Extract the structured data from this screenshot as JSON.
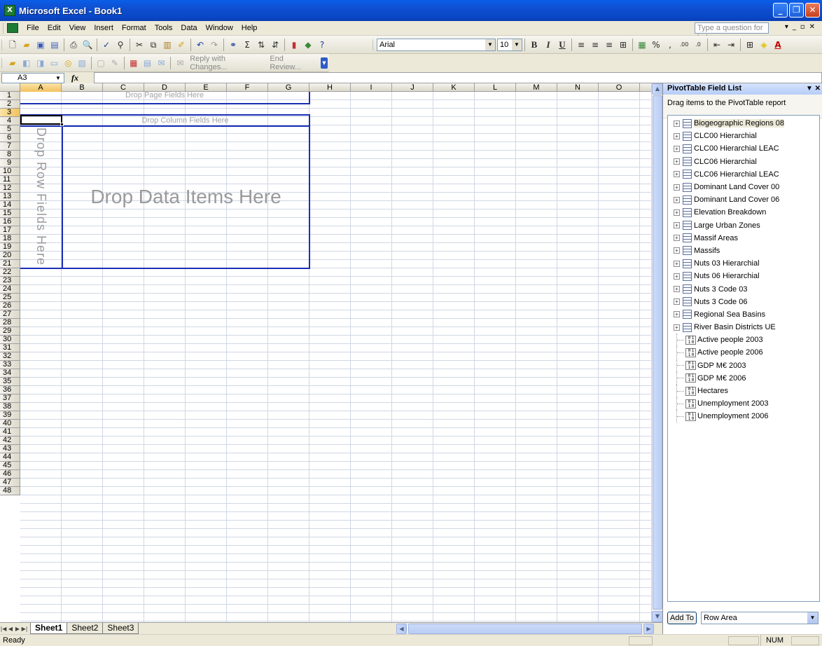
{
  "window": {
    "title": "Microsoft Excel - Book1",
    "app_icon": "X"
  },
  "menubar": {
    "items": [
      "File",
      "Edit",
      "View",
      "Insert",
      "Format",
      "Tools",
      "Data",
      "Window",
      "Help"
    ],
    "help_placeholder": "Type a question for help"
  },
  "toolbar_format": {
    "font": "Arial",
    "size": "10"
  },
  "toolbar_review": {
    "reply_label": "Reply with Changes...",
    "end_review_label": "End Review..."
  },
  "formula_bar": {
    "name_box": "A3",
    "fx_label": "fx",
    "formula": ""
  },
  "grid": {
    "columns": [
      "A",
      "B",
      "C",
      "D",
      "E",
      "F",
      "G",
      "H",
      "I",
      "J",
      "K",
      "L",
      "M",
      "N",
      "O"
    ],
    "selected_column": "A",
    "rows": [
      "1",
      "2",
      "3",
      "4",
      "5",
      "6",
      "7",
      "8",
      "9",
      "10",
      "11",
      "12",
      "13",
      "14",
      "15",
      "16",
      "17",
      "18",
      "19",
      "20",
      "21",
      "22",
      "23",
      "24",
      "25",
      "26",
      "27",
      "28",
      "29",
      "30",
      "31",
      "32",
      "33",
      "34",
      "35",
      "36",
      "37",
      "38",
      "39",
      "40",
      "41",
      "42",
      "43",
      "44",
      "45",
      "46",
      "47",
      "48"
    ],
    "selected_row": "3"
  },
  "pivot": {
    "page_drop": "Drop Page Fields Here",
    "column_drop": "Drop Column Fields Here",
    "row_drop": "Drop Row Fields Here",
    "data_drop": "Drop Data Items Here"
  },
  "sheets": {
    "tabs": [
      "Sheet1",
      "Sheet2",
      "Sheet3"
    ],
    "active": "Sheet1"
  },
  "status": {
    "left": "Ready",
    "num": "NUM"
  },
  "pane": {
    "title": "PivotTable Field List",
    "description": "Drag items to the PivotTable report",
    "dimension_fields": [
      "Biogeographic Regions 08",
      "CLC00 Hierarchial",
      "CLC00 Hierarchial LEAC",
      "CLC06 Hierarchial",
      "CLC06 Hierarchial LEAC",
      "Dominant Land Cover 00",
      "Dominant Land Cover 06",
      "Elevation Breakdown",
      "Large Urban Zones",
      "Massif Areas",
      "Massifs",
      "Nuts 03 Hierarchial",
      "Nuts 06  Hierarchial",
      "Nuts 3 Code 03",
      "Nuts 3 Code 06",
      "Regional Sea Basins",
      "River Basin Districts UE"
    ],
    "measure_fields": [
      "Active people 2003",
      "Active people 2006",
      "GDP M€ 2003",
      "GDP M€ 2006",
      "Hectares",
      "Unemployment 2003",
      "Unemployment 2006"
    ],
    "measure_icon_text": "0 1\n1 0",
    "add_to_label": "Add To",
    "area_value": "Row Area"
  }
}
